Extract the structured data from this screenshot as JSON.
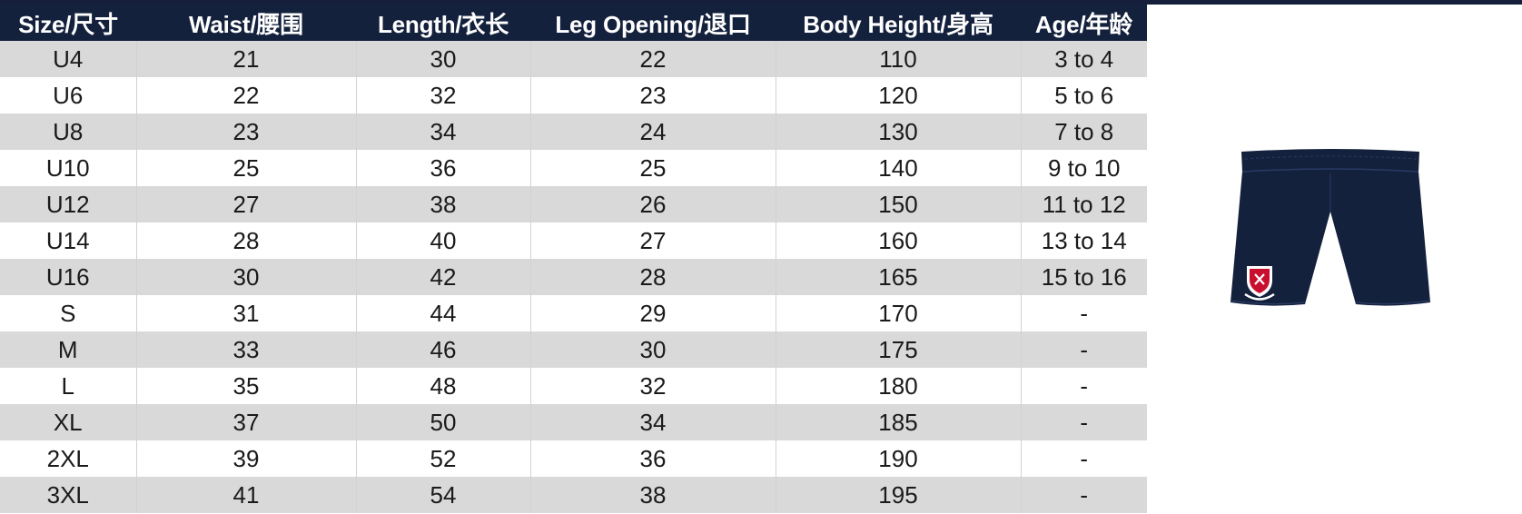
{
  "size_chart": {
    "headers": [
      "Size/尺寸",
      "Waist/腰围",
      "Length/衣长",
      "Leg Opening/退口",
      "Body Height/身高",
      "Age/年龄"
    ],
    "rows": [
      [
        "U4",
        "21",
        "30",
        "22",
        "110",
        "3 to 4"
      ],
      [
        "U6",
        "22",
        "32",
        "23",
        "120",
        "5 to 6"
      ],
      [
        "U8",
        "23",
        "34",
        "24",
        "130",
        "7 to 8"
      ],
      [
        "U10",
        "25",
        "36",
        "25",
        "140",
        "9 to 10"
      ],
      [
        "U12",
        "27",
        "38",
        "26",
        "150",
        "11 to 12"
      ],
      [
        "U14",
        "28",
        "40",
        "27",
        "160",
        "13 to 14"
      ],
      [
        "U16",
        "30",
        "42",
        "28",
        "165",
        "15 to 16"
      ],
      [
        "S",
        "31",
        "44",
        "29",
        "170",
        "-"
      ],
      [
        "M",
        "33",
        "46",
        "30",
        "175",
        "-"
      ],
      [
        "L",
        "35",
        "48",
        "32",
        "180",
        "-"
      ],
      [
        "XL",
        "37",
        "50",
        "34",
        "185",
        "-"
      ],
      [
        "2XL",
        "39",
        "52",
        "36",
        "190",
        "-"
      ],
      [
        "3XL",
        "41",
        "54",
        "38",
        "195",
        "-"
      ]
    ]
  },
  "colors": {
    "header_background": "#14213d",
    "header_text": "#ffffff",
    "stripe_row": "#d9d9d9",
    "plain_row": "#ffffff",
    "garment": "#14213d",
    "crest_red": "#c8102e"
  },
  "product": {
    "icon": "navy-shorts-with-crest"
  }
}
